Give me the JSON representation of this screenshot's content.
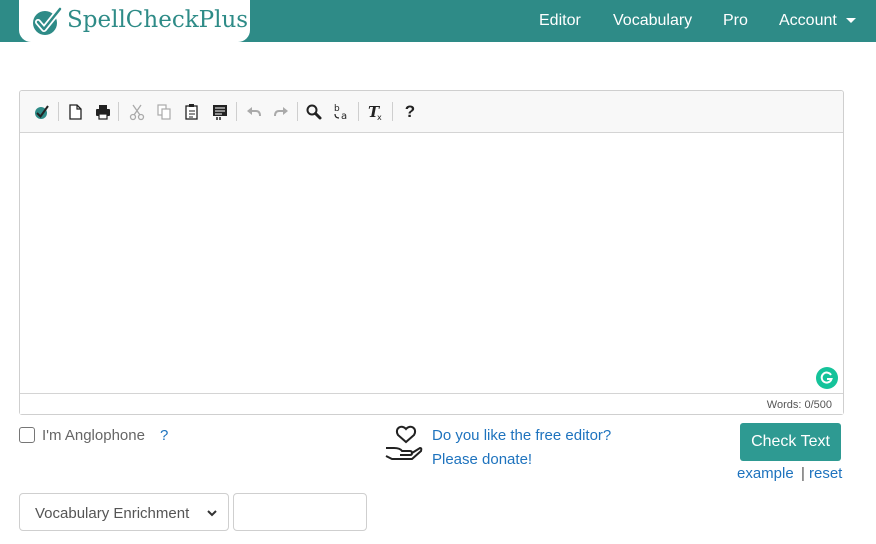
{
  "brand": {
    "name": "SpellCheckPlus",
    "icon": "check-badge-icon",
    "color": "#2e8b87"
  },
  "nav": {
    "links": [
      "Editor",
      "Vocabulary",
      "Pro",
      "Account"
    ],
    "account_icon": "caret-down-icon"
  },
  "toolbar": {
    "buttons": [
      "spellcheck-icon",
      "new-document-icon",
      "print-icon",
      "cut-icon",
      "copy-icon",
      "paste-icon",
      "paste-text-icon",
      "undo-icon",
      "redo-icon",
      "find-icon",
      "replace-icon",
      "remove-format-icon",
      "help-icon"
    ],
    "help_glyph": "?"
  },
  "editor": {
    "word_count": "Words: 0/500",
    "grammarly_icon": "grammarly-icon"
  },
  "options": {
    "anglophone_label": "I'm Anglophone",
    "anglophone_help": "?",
    "anglophone_checked": false
  },
  "donate": {
    "icon": "heart-hand-icon",
    "line1": "Do you like the free editor?",
    "line2": "Please donate!"
  },
  "actions": {
    "check_label": "Check Text",
    "example_label": "example",
    "separator": "|",
    "reset_label": "reset"
  },
  "vocab": {
    "selected": "Vocabulary Enrichment",
    "input_value": ""
  },
  "colors": {
    "primary": "#2e8b87",
    "button": "#2e9a92",
    "link": "#1e73be"
  }
}
